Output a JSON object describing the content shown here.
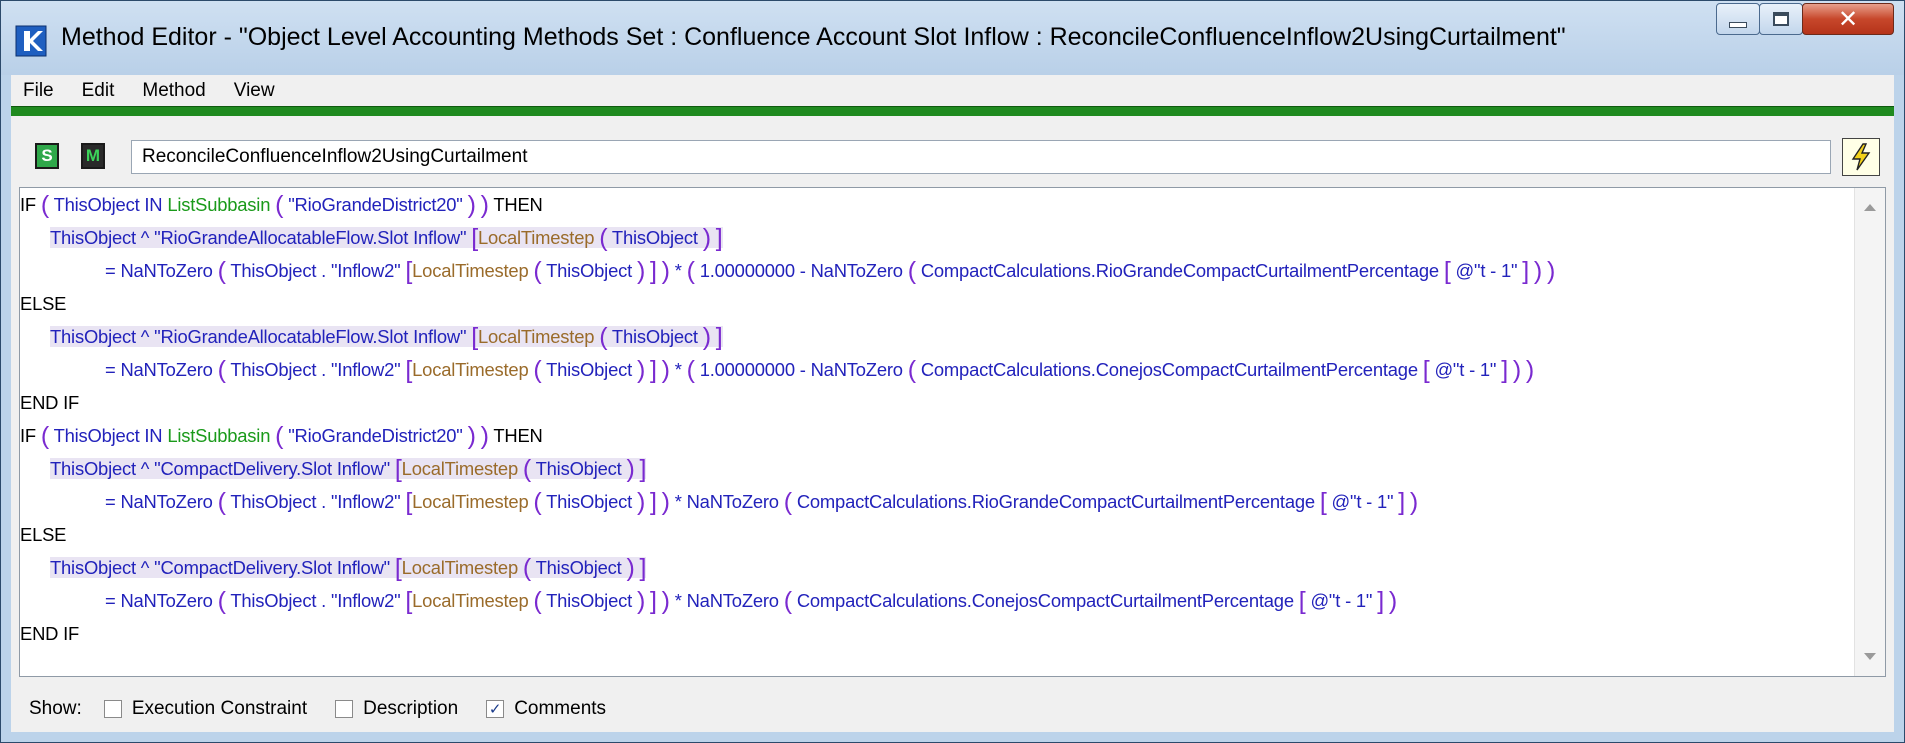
{
  "window": {
    "title": "Method Editor - \"Object Level Accounting Methods Set : Confluence Account Slot Inflow : ReconcileConfluenceInflow2UsingCurtailment\""
  },
  "menu": [
    "File",
    "Edit",
    "Method",
    "View"
  ],
  "toolbar": {
    "s_icon": "S",
    "m_icon": "M",
    "method_name": "ReconcileConfluenceInflow2UsingCurtailment"
  },
  "code": {
    "if1_a": "IF",
    "if1_obj": "ThisObject IN",
    "if1_fn": "ListSubbasin",
    "if1_str": "\"RioGrandeDistrict20\"",
    "then": "THEN",
    "slot_a": "ThisObject ^ \"RioGrandeAllocatableFlow.Slot Inflow\"",
    "slot_b": "ThisObject ^ \"CompactDelivery.Slot Inflow\"",
    "local_ts": "LocalTimestep",
    "this_obj": "ThisObject",
    "eq_nan": "= NaNToZero",
    "inflow2": "ThisObject . \"Inflow2\"",
    "times": "*",
    "one_minus": "1.00000000 - NaNToZero",
    "times_nan": "* NaNToZero",
    "rg_pct": "CompactCalculations.RioGrandeCompactCurtailmentPercentage",
    "cj_pct": "CompactCalculations.ConejosCompactCurtailmentPercentage",
    "tminus": "@\"t - 1\"",
    "else": "ELSE",
    "endif": "END IF"
  },
  "show": {
    "label": "Show:",
    "options": [
      {
        "label": "Execution Constraint",
        "checked": false
      },
      {
        "label": "Description",
        "checked": false
      },
      {
        "label": "Comments",
        "checked": true
      }
    ]
  }
}
